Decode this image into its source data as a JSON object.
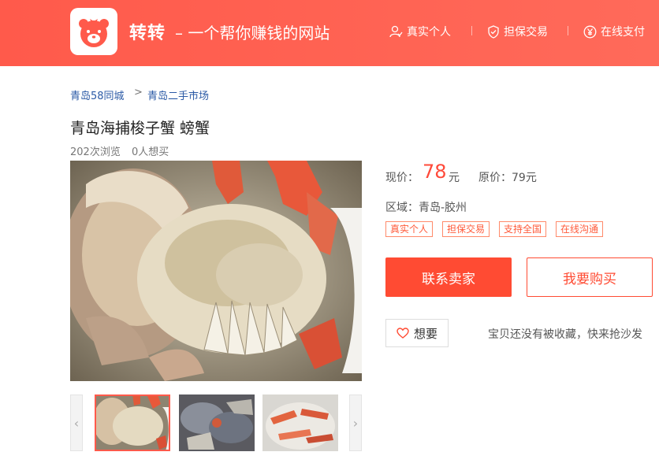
{
  "header": {
    "brand": "转转",
    "slogan": "– 一个帮你赚钱的网站",
    "features": [
      {
        "icon": "person-check-icon",
        "label": "真实个人"
      },
      {
        "icon": "shield-icon",
        "label": "担保交易"
      },
      {
        "icon": "yen-circle-icon",
        "label": "在线支付"
      }
    ]
  },
  "breadcrumb": {
    "items": [
      "青岛58同城",
      "青岛二手市场"
    ],
    "separator": ">"
  },
  "product": {
    "title": "青岛海捕梭子蟹 螃蟹",
    "views": "202次浏览",
    "wants": "0人想买",
    "price_label": "现价：",
    "price": "78",
    "price_unit": "元",
    "original_price": "原价：79元",
    "region": "区域：青岛-胶州",
    "tags": [
      "真实个人",
      "担保交易",
      "支持全国",
      "在线沟通"
    ]
  },
  "actions": {
    "contact_seller": "联系卖家",
    "buy": "我要购买",
    "want": "想要",
    "favorite_hint": "宝贝还没有被收藏，快来抢沙发"
  },
  "thumbnails": {
    "prev": "‹",
    "next": "›",
    "count": 3,
    "active_index": 0
  },
  "colors": {
    "brand_red": "#ff5a4b",
    "button_red": "#ff4b33",
    "price_red": "#ff4a3a",
    "link_blue": "#2b5aa6"
  }
}
